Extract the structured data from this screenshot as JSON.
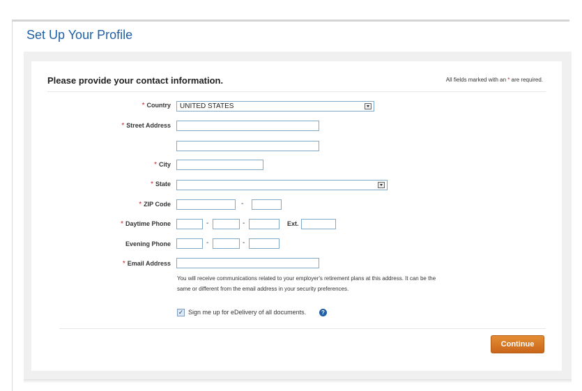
{
  "page": {
    "title": "Set Up Your Profile"
  },
  "section": {
    "heading": "Please provide your contact information.",
    "required_note_prefix": "All fields marked with an",
    "required_note_star": "*",
    "required_note_suffix": "are required."
  },
  "form": {
    "required_marker": "*",
    "country": {
      "label": "Country",
      "value": "UNITED STATES"
    },
    "street": {
      "label": "Street Address",
      "line1": "",
      "line2": ""
    },
    "city": {
      "label": "City",
      "value": ""
    },
    "state": {
      "label": "State",
      "value": ""
    },
    "zip": {
      "label": "ZIP Code",
      "value": "",
      "ext_value": "",
      "separator": "-"
    },
    "daytime_phone": {
      "label": "Daytime Phone",
      "separator": "-",
      "ext_label": "Ext."
    },
    "evening_phone": {
      "label": "Evening Phone",
      "separator": "-"
    },
    "email": {
      "label": "Email Address",
      "value": "",
      "help": "You will receive communications related to your employer's retirement plans at this address. It can be the same or different from the email address in your security preferences."
    },
    "edelivery": {
      "label": "Sign me up for eDelivery of all documents.",
      "checked": true,
      "check_glyph": "✓",
      "help_glyph": "?"
    }
  },
  "actions": {
    "continue_label": "Continue"
  },
  "colors": {
    "title_blue": "#1f5fa5",
    "required_red": "#c8202a",
    "button_orange": "#d9782a",
    "field_border": "#7ea9c9"
  }
}
